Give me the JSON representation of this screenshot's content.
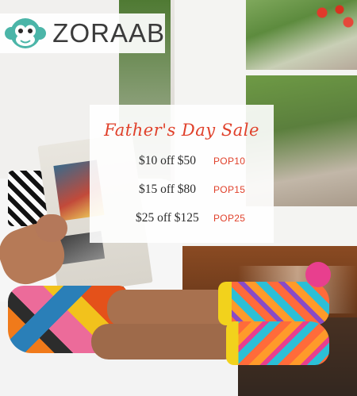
{
  "brand": {
    "name": "ZORAAB",
    "logo_icon": "monkey-face-icon",
    "logo_color": "#4bb5a8"
  },
  "promo": {
    "title": "Father's Day Sale",
    "title_color": "#e0412b",
    "deals": [
      {
        "amount": "$10 off $50",
        "code": "POP10"
      },
      {
        "amount": "$15 off $80",
        "code": "POP15"
      },
      {
        "amount": "$25 off $125",
        "code": "POP25"
      }
    ]
  }
}
